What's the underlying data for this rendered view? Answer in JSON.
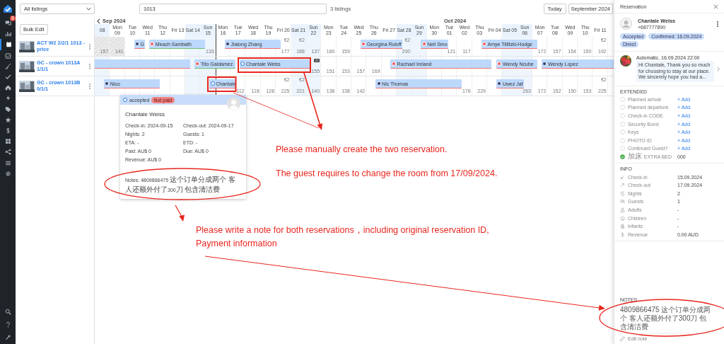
{
  "nav": {
    "top": [
      {
        "selected": false,
        "badge": "8"
      },
      {
        "selected": false
      },
      {
        "selected": true
      },
      {
        "selected": false
      },
      {
        "selected": false
      },
      {
        "selected": false
      },
      {
        "selected": false
      },
      {
        "selected": false
      },
      {
        "selected": false
      },
      {
        "selected": false
      },
      {
        "selected": false
      },
      {
        "selected": false
      },
      {
        "selected": false
      },
      {
        "selected": false
      },
      {
        "selected": false
      }
    ],
    "bottom": [
      {
        "selected": false
      },
      {
        "selected": false
      },
      {
        "selected": false
      }
    ]
  },
  "toolbar": {
    "listing_filter": "All listings",
    "search": "1013",
    "count": "3 listings",
    "today": "Today",
    "month": "September 2024"
  },
  "bulk_edit": "Bulk Edit",
  "listings": [
    {
      "name": "ACT W2 2/2/1 1013 - price"
    },
    {
      "name": "GC - crown 1013A 1/1/1"
    },
    {
      "name": "GC - crown 1013B 0/1/1"
    }
  ],
  "calendar": {
    "days": [
      {
        "label": "08",
        "weekend": true,
        "today": false,
        "month": "Sep 2024"
      },
      {
        "label": "Mon 09",
        "weekend": false,
        "today": false
      },
      {
        "label": "Tue 10",
        "weekend": false,
        "today": false
      },
      {
        "label": "Wed 11",
        "weekend": false,
        "today": false
      },
      {
        "label": "Thu 12",
        "weekend": false,
        "today": false
      },
      {
        "label": "Fri 13",
        "weekend": false,
        "today": false
      },
      {
        "label": "Sat 14",
        "weekend": true,
        "today": false
      },
      {
        "label": "Sun 15",
        "weekend": true,
        "today": false
      },
      {
        "label": "Mon 16",
        "weekend": false,
        "today": true
      },
      {
        "label": "Tue 17",
        "weekend": false,
        "today": false
      },
      {
        "label": "Wed 18",
        "weekend": false,
        "today": false
      },
      {
        "label": "Thu 19",
        "weekend": false,
        "today": false
      },
      {
        "label": "Fri 20",
        "weekend": false,
        "today": false
      },
      {
        "label": "Sat 21",
        "weekend": true,
        "today": false
      },
      {
        "label": "Sun 22",
        "weekend": true,
        "today": false
      },
      {
        "label": "Mon 23",
        "weekend": false,
        "today": false
      },
      {
        "label": "Tue 24",
        "weekend": false,
        "today": false
      },
      {
        "label": "Wed 25",
        "weekend": false,
        "today": false
      },
      {
        "label": "Thu 26",
        "weekend": false,
        "today": false
      },
      {
        "label": "Fri 27",
        "weekend": false,
        "today": false
      },
      {
        "label": "Sat 28",
        "weekend": true,
        "today": false
      },
      {
        "label": "Sun 29",
        "weekend": true,
        "today": false
      },
      {
        "label": "Mon 30",
        "weekend": false,
        "today": false
      },
      {
        "label": "Tue 01",
        "weekend": false,
        "today": false,
        "month": "Oct 2024"
      },
      {
        "label": "Wed 02",
        "weekend": false,
        "today": false
      },
      {
        "label": "Thu 03",
        "weekend": false,
        "today": false
      },
      {
        "label": "Fri 04",
        "weekend": false,
        "today": false
      },
      {
        "label": "Sat 05",
        "weekend": true,
        "today": false
      },
      {
        "label": "Sun 06",
        "weekend": true,
        "today": false
      },
      {
        "label": "Mon 07",
        "weekend": false,
        "today": false
      },
      {
        "label": "Tue 08",
        "weekend": false,
        "today": false
      },
      {
        "label": "Wed 09",
        "weekend": false,
        "today": false
      },
      {
        "label": "Thu 10",
        "weekend": false,
        "today": false
      },
      {
        "label": "Fri 11",
        "weekend": false,
        "today": false
      }
    ],
    "rows": [
      {
        "cells": [
          {
            "price": "157",
            "blocked": true,
            "flag": false
          },
          {
            "price": "141",
            "blocked": true,
            "flag": false
          },
          {
            "blocked": false,
            "flag": false
          },
          {
            "blocked": false,
            "flag": false
          },
          {
            "blocked": false,
            "flag": false
          },
          {
            "blocked": false,
            "flag": false
          },
          {
            "blocked": false,
            "flag": false
          },
          {
            "price": "133",
            "blocked": false,
            "flag": false
          },
          {
            "blocked": false,
            "flag": false
          },
          {
            "blocked": false,
            "flag": false
          },
          {
            "blocked": false,
            "flag": false
          },
          {
            "blocked": false,
            "flag": false
          },
          {
            "fee": "€2",
            "price": "177",
            "blocked": false,
            "flag": false
          },
          {
            "fee": "€2",
            "price": "188",
            "blocked": false,
            "flag": false
          },
          {
            "price": "137",
            "blocked": false,
            "flag": false
          },
          {
            "price": "160",
            "blocked": false,
            "flag": false
          },
          {
            "price": "159",
            "blocked": false,
            "flag": false
          },
          {
            "blocked": false,
            "flag": false
          },
          {
            "blocked": false,
            "flag": false
          },
          {
            "blocked": false,
            "flag": false
          },
          {
            "fee": "€2",
            "price": "200",
            "blocked": false,
            "flag": false
          },
          {
            "blocked": false,
            "flag": false
          },
          {
            "blocked": false,
            "flag": false
          },
          {
            "price": "121",
            "blocked": false,
            "flag": false
          },
          {
            "price": "117",
            "blocked": false,
            "flag": false
          },
          {
            "blocked": false,
            "flag": false
          },
          {
            "blocked": false,
            "flag": false
          },
          {
            "blocked": false,
            "flag": false
          },
          {
            "blocked": false,
            "flag": false
          },
          {
            "price": "172",
            "blocked": false,
            "flag": false
          },
          {
            "price": "157",
            "blocked": false,
            "flag": false
          },
          {
            "price": "154",
            "blocked": false,
            "flag": false
          },
          {
            "price": "150",
            "blocked": false,
            "flag": false
          },
          {
            "fee": "€2",
            "price": "192",
            "blocked": false,
            "flag": false
          }
        ],
        "bars": [
          {
            "name": "G",
            "kind": "badge",
            "color": "#f07272"
          },
          {
            "name": "Meach Sambath",
            "kind": "dot",
            "color": "#6cc070"
          },
          {
            "name": "Jialong Zhang",
            "kind": "badge",
            "color": "#f07272"
          },
          {
            "name": "Georgina Ruloff",
            "kind": "dot",
            "color": "#f07272"
          },
          {
            "name": "Neil Smo",
            "kind": "dot",
            "color": "#f07272"
          },
          {
            "name": "Amye Tillitzki-Hodge",
            "kind": "dot",
            "color": "#f07272"
          }
        ]
      },
      {
        "cells": [
          {
            "blocked": false,
            "flag": false
          },
          {
            "blocked": false,
            "flag": false
          },
          {
            "blocked": false,
            "flag": false
          },
          {
            "blocked": false,
            "flag": false
          },
          {
            "blocked": false,
            "flag": false
          },
          {
            "blocked": false,
            "flag": false
          },
          {
            "blocked": false,
            "flag": false
          },
          {
            "blocked": false,
            "flag": false
          },
          {
            "blocked": false,
            "flag": false
          },
          {
            "blocked": false,
            "flag": false
          },
          {
            "blocked": false,
            "flag": false
          },
          {
            "blocked": false,
            "flag": false
          },
          {
            "blocked": false,
            "flag": false
          },
          {
            "blocked": false,
            "flag": false
          },
          {
            "price": "155",
            "blocked": false,
            "flag": true
          },
          {
            "price": "151",
            "blocked": false,
            "flag": false
          },
          {
            "price": "153",
            "blocked": false,
            "flag": false
          },
          {
            "price": "157",
            "blocked": false,
            "flag": false
          },
          {
            "price": "169",
            "blocked": false,
            "flag": false
          },
          {
            "blocked": false,
            "flag": false
          },
          {
            "blocked": false,
            "flag": false
          },
          {
            "blocked": false,
            "flag": false
          },
          {
            "blocked": false,
            "flag": false
          },
          {
            "blocked": false,
            "flag": false
          },
          {
            "blocked": false,
            "flag": false
          },
          {
            "blocked": false,
            "flag": false
          },
          {
            "blocked": false,
            "flag": false
          },
          {
            "blocked": false,
            "flag": false
          },
          {
            "blocked": false,
            "flag": false
          },
          {
            "blocked": false,
            "flag": false
          },
          {
            "blocked": false,
            "flag": false
          },
          {
            "blocked": false,
            "flag": false
          },
          {
            "blocked": false,
            "flag": false
          },
          {
            "blocked": false,
            "flag": false
          }
        ],
        "bars": [
          {
            "kind": "plain",
            "color": "#f07272"
          },
          {
            "name": "Tito Galdamez",
            "kind": "dot",
            "color": "#6cc070"
          },
          {
            "name": "Chantale Weiss",
            "kind": "ring",
            "color": "#f07272"
          },
          {
            "name": "Rachael Ireland",
            "kind": "dot",
            "color": "#f07272"
          },
          {
            "name": "Wendy Ncube",
            "kind": "dot",
            "color": "#f07272"
          },
          {
            "name": "Wendy Lopez",
            "kind": "badge",
            "color": "#f07272"
          }
        ]
      },
      {
        "cells": [
          {
            "blocked": false,
            "flag": false
          },
          {
            "blocked": false,
            "flag": false
          },
          {
            "blocked": false,
            "flag": false
          },
          {
            "blocked": false,
            "flag": false
          },
          {
            "blocked": false,
            "flag": false
          },
          {
            "blocked": false,
            "flag": false
          },
          {
            "blocked": false,
            "flag": false
          },
          {
            "blocked": false,
            "flag": false
          },
          {
            "blocked": false,
            "flag": false
          },
          {
            "price": "112",
            "blocked": false,
            "flag": false
          },
          {
            "price": "118",
            "blocked": false,
            "flag": false
          },
          {
            "price": "128",
            "blocked": false,
            "flag": false
          },
          {
            "fee": "€2",
            "price": "225",
            "blocked": false,
            "flag": false
          },
          {
            "fee": "€2",
            "price": "221",
            "blocked": false,
            "flag": false
          },
          {
            "price": "140",
            "blocked": false,
            "flag": false
          },
          {
            "price": "136",
            "blocked": false,
            "flag": false
          },
          {
            "price": "138",
            "blocked": false,
            "flag": false
          },
          {
            "price": "142",
            "blocked": false,
            "flag": false
          },
          {
            "blocked": false,
            "flag": false
          },
          {
            "blocked": false,
            "flag": false
          },
          {
            "blocked": false,
            "flag": false
          },
          {
            "blocked": false,
            "flag": false
          },
          {
            "blocked": false,
            "flag": false
          },
          {
            "blocked": false,
            "flag": false
          },
          {
            "price": "176",
            "blocked": false,
            "flag": false
          },
          {
            "price": "229",
            "blocked": false,
            "flag": false
          },
          {
            "blocked": false,
            "flag": false
          },
          {
            "blocked": false,
            "flag": false
          },
          {
            "price": "263",
            "blocked": false,
            "flag": false
          },
          {
            "price": "172",
            "blocked": false,
            "flag": false
          },
          {
            "price": "152",
            "blocked": false,
            "flag": false
          },
          {
            "price": "150",
            "blocked": false,
            "flag": false
          },
          {
            "price": "153",
            "blocked": false,
            "flag": false
          },
          {
            "fee": "€2",
            "price": "225",
            "blocked": false,
            "flag": false
          }
        ],
        "bars": [
          {
            "name": "Nico",
            "kind": "badge",
            "color": "#f07272"
          },
          {
            "name": "Chantale",
            "kind": "ring",
            "color": "#f07272"
          },
          {
            "name": "Nic Thomas",
            "kind": "badge",
            "color": "#f07272"
          },
          {
            "name": "Uwez Jaf",
            "kind": "badge",
            "color": "#f07272"
          }
        ]
      }
    ]
  },
  "popup": {
    "status": "accepted",
    "payment": "Not paid",
    "guest": "Chantale Weiss",
    "details": [
      "Check-in: 2024-09-15",
      "Check-out: 2024-09-17",
      "Nights: 2",
      "Guests: 1",
      "ETA: -",
      "ETD: -",
      "Paid: AU$ 0",
      "Due: AU$ 0",
      "Revenue: AU$ 0"
    ],
    "notes_label": "Notes:",
    "notes": "4809866475 这个订单分成两个 客人还额外付了300刀 包含清洁费"
  },
  "annotations": [
    "Please manually create the two reservation.",
    "The guest requires to change the room from 17/09/2024.",
    "Please write a note for both reservations，including original reservation ID,",
    "Payment information"
  ],
  "panel": {
    "title": "Reservation",
    "guest": {
      "name": "Chantale Weiss",
      "phone": "+687777890"
    },
    "tags": [
      "Accepted",
      "Confirmed: 16.09.2024",
      "Direct"
    ],
    "message": {
      "meta": "Automatic, 16.09.2024 22:00",
      "text": "Hi Chantale, Thank you so much for choosing to stay at our place. We sincerely hope you had a..."
    },
    "extended": {
      "title": "EXTENDED",
      "items": [
        {
          "label": "Planned arrival",
          "checked": false,
          "kind": "add",
          "action": "+ Add"
        },
        {
          "label": "Planned departure",
          "checked": false,
          "kind": "add",
          "action": "+ Add"
        },
        {
          "label": "Check-in CODE",
          "checked": false,
          "kind": "add",
          "action": "+ Add"
        },
        {
          "label": "Security Bond",
          "checked": false,
          "kind": "add",
          "action": "+ Add"
        },
        {
          "label": "Keys",
          "checked": false,
          "kind": "add",
          "action": "+ Add"
        },
        {
          "label": "PHOTO ID",
          "checked": false,
          "kind": "add",
          "action": "+ Add"
        },
        {
          "label": "Continued Guest?",
          "checked": false,
          "kind": "add",
          "action": "+ Add"
        },
        {
          "label": "加床 EXTRA BED",
          "checked": true,
          "kind": "value",
          "value": "000"
        }
      ]
    },
    "info": {
      "title": "INFO",
      "items": [
        {
          "label": "Check-in",
          "value": "15.09.2024"
        },
        {
          "label": "Check-out",
          "value": "17.09.2024"
        },
        {
          "label": "Nights",
          "value": "2"
        },
        {
          "label": "Guests",
          "value": "1"
        },
        {
          "label": "Adults",
          "value": "-"
        },
        {
          "label": "Children",
          "value": "-"
        },
        {
          "label": "Infants",
          "value": "-"
        },
        {
          "label": "Revenue",
          "value": "0.00 AUD"
        }
      ]
    },
    "notes": {
      "title": "NOTES",
      "text": "4809866475 这个订单分成两个 客人还额外付了300刀 包含清洁费",
      "edit": "Edit note"
    }
  }
}
